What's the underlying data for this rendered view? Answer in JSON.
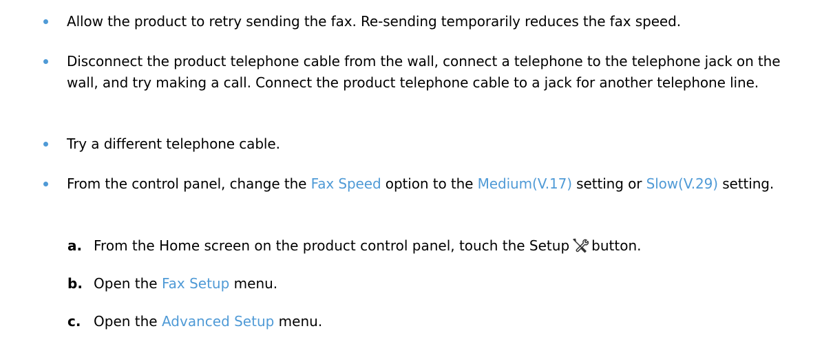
{
  "bullets": [
    {
      "text": "Allow the product to retry sending the fax. Re-sending temporarily reduces the fax speed."
    },
    {
      "text": "Disconnect the product telephone cable from the wall, connect a telephone to the telephone jack on the wall, and try making a call. Connect the product telephone cable to a jack for another telephone line."
    },
    {
      "text": "Try a different telephone cable."
    },
    {
      "part1": "From the control panel, change the ",
      "ui1": "Fax Speed",
      "part2": " option to the ",
      "ui2": "Medium(V.17)",
      "part3": " setting or ",
      "ui3": "Slow(V.29)",
      "part4": " setting."
    }
  ],
  "steps": [
    {
      "label": "a.",
      "before": "From the Home screen on the product control panel, touch the Setup",
      "icon": "wrench-screwdriver-icon",
      "after": "button."
    },
    {
      "label": "b.",
      "before": "Open the ",
      "ui": "Fax Setup",
      "after": " menu."
    },
    {
      "label": "c.",
      "before": "Open the ",
      "ui": "Advanced Setup",
      "after": " menu."
    }
  ],
  "colors": {
    "accent": "#4f9ad6",
    "text": "#000000"
  }
}
